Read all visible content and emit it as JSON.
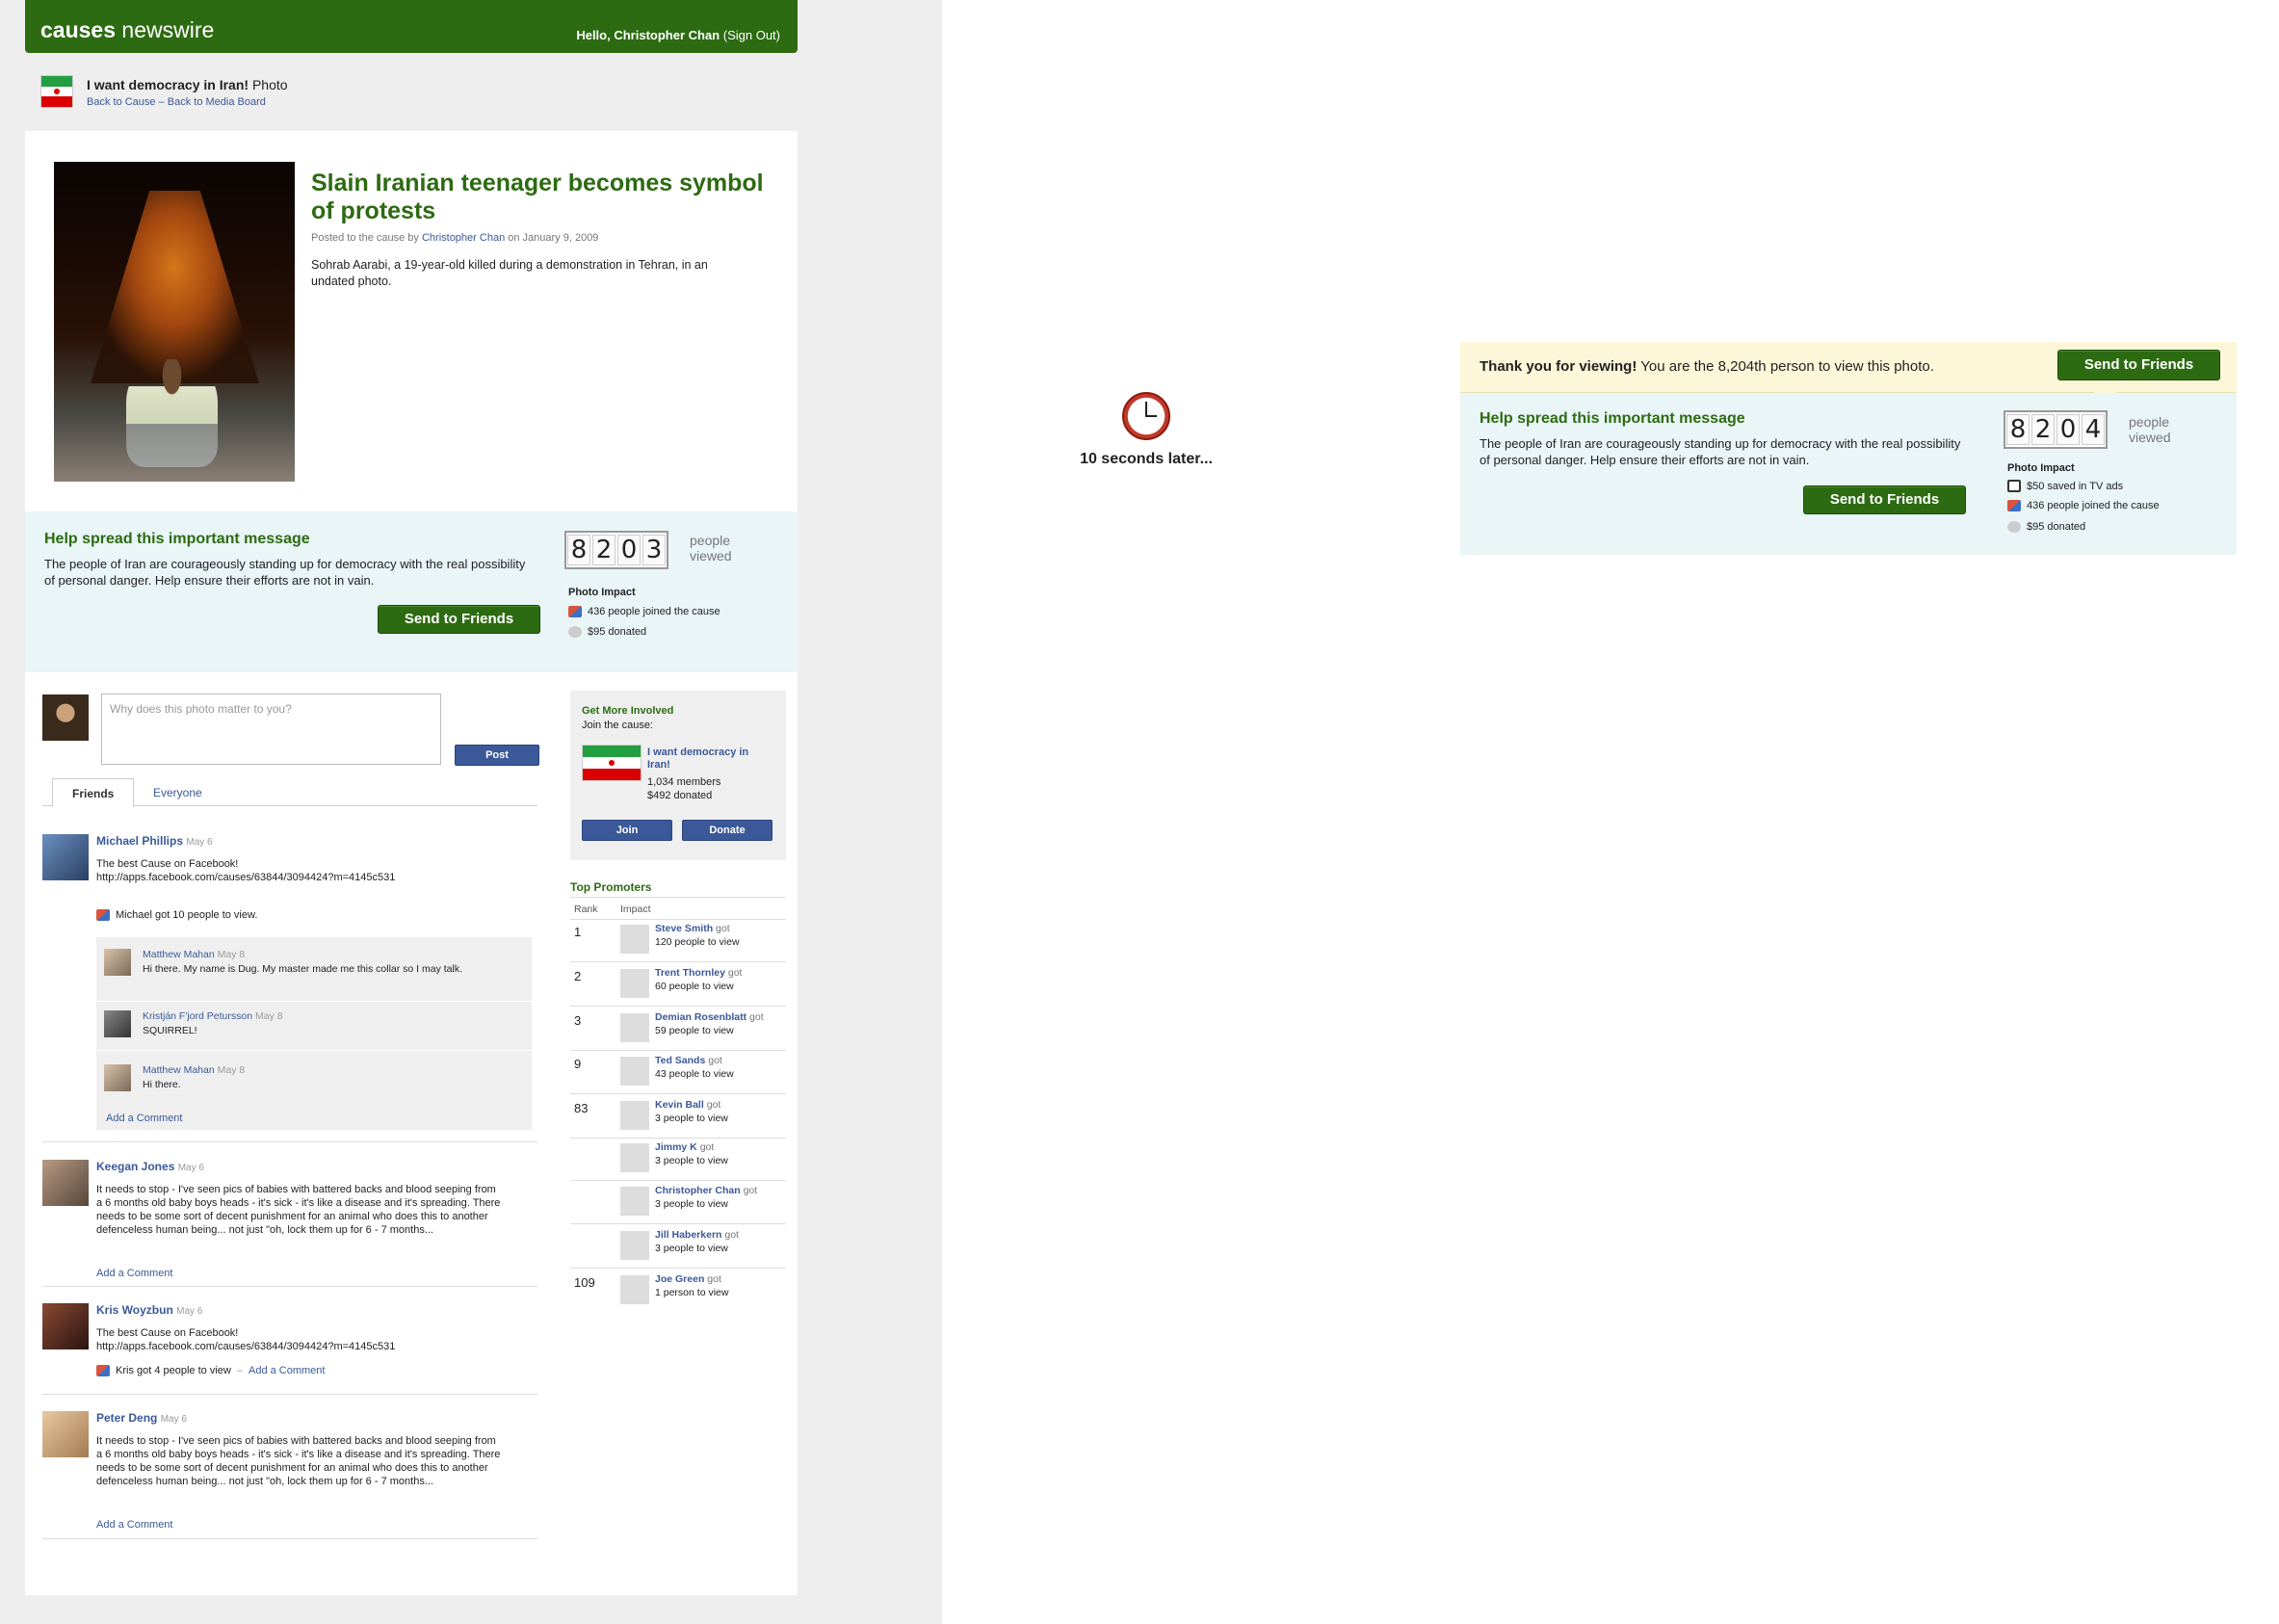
{
  "header": {
    "brand_bold": "causes",
    "brand_rest": " newswire",
    "greeting": "Hello, Christopher Chan",
    "signout": "(Sign Out)"
  },
  "cause_bar": {
    "title": "I want democracy in Iran!",
    "type": "Photo",
    "back_cause": "Back to Cause",
    "dash": " – ",
    "back_media": "Back to Media Board"
  },
  "article": {
    "headline": "Slain Iranian teenager becomes symbol of protests",
    "posted_prefix": "Posted to the cause by ",
    "posted_author": "Christopher Chan",
    "posted_suffix": " on January 9, 2009",
    "caption": "Sohrab Aarabi, a 19-year-old killed during a demonstration in Tehran, in an undated photo."
  },
  "spread": {
    "heading": "Help spread this important message",
    "body": "The people of Iran are courageously standing up for democracy with the real possibility of personal danger. Help ensure their efforts are not in vain.",
    "button": "Send to Friends",
    "digits": [
      "8",
      "2",
      "0",
      "3"
    ],
    "people_viewed": "people viewed",
    "impact_title": "Photo Impact",
    "impact_joined": "436 people joined the cause",
    "impact_donated": "$95 donated"
  },
  "comment": {
    "placeholder": "Why does this photo matter to you?",
    "post_button": "Post"
  },
  "tabs": {
    "friends": "Friends",
    "everyone": "Everyone"
  },
  "posts": [
    {
      "name": "Michael Phillips",
      "date": "May 6",
      "body": "The best Cause on Facebook!\nhttp://apps.facebook.com/causes/63844/3094424?m=4145c531",
      "meta": "Michael got 10 people to view."
    },
    {
      "name": "Keegan Jones",
      "date": "May 6",
      "body": "It needs to stop - I've seen pics of babies with battered backs and blood seeping from a 6 months old baby boys heads - it's sick - it's like a disease and it's spreading. There needs to be some sort of decent punishment for an animal who does this to another defenceless human being... not just \"oh, lock them up for 6 - 7 months...",
      "add_comment": "Add a Comment"
    },
    {
      "name": "Kris Woyzbun",
      "date": "May 6",
      "body": "The best Cause on Facebook!\nhttp://apps.facebook.com/causes/63844/3094424?m=4145c531",
      "meta": "Kris got 4 people to view",
      "meta_sep": " – ",
      "add_comment": "Add a Comment"
    },
    {
      "name": "Peter Deng",
      "date": "May 6",
      "body": "It needs to stop - I've seen pics of babies with battered backs and blood seeping from a 6 months old baby boys heads - it's sick - it's like a disease and it's spreading. There needs to be some sort of decent punishment for an animal who does this to another defenceless human being... not just \"oh, lock them up for 6 - 7 months...",
      "add_comment": "Add a Comment"
    }
  ],
  "replies": [
    {
      "name": "Matthew Mahan",
      "date": "May 8",
      "body": "Hi there. My name is Dug. My master made me this collar so I may talk."
    },
    {
      "name": "Kristján F'jord Petursson",
      "date": "May 8",
      "body": "SQUIRREL!"
    },
    {
      "name": "Matthew Mahan",
      "date": "May 8",
      "body": "Hi there."
    }
  ],
  "replies_add_comment": "Add a Comment",
  "involved": {
    "heading": "Get More Involved",
    "sub": "Join the cause:",
    "cause_name": "I want democracy in Iran!",
    "members": "1,034 members",
    "donated": "$492 donated",
    "join": "Join",
    "donate": "Donate"
  },
  "promoters": {
    "heading": "Top Promoters",
    "col_rank": "Rank",
    "col_impact": "Impact",
    "got": " got",
    "rows": [
      {
        "rank": "1",
        "name": "Steve Smith",
        "impact": "120 people to view"
      },
      {
        "rank": "2",
        "name": "Trent Thornley",
        "impact": "60 people to view"
      },
      {
        "rank": "3",
        "name": "Demian Rosenblatt",
        "impact": "59 people to view"
      },
      {
        "rank": "9",
        "name": "Ted Sands",
        "impact": "43 people to view"
      },
      {
        "rank": "83",
        "name": "Kevin Ball",
        "impact": "3 people to view"
      },
      {
        "rank": "",
        "name": "Jimmy K",
        "impact": "3 people to view"
      },
      {
        "rank": "",
        "name": "Christopher Chan",
        "impact": "3 people to view"
      },
      {
        "rank": "",
        "name": "Jill Haberkern",
        "impact": "3 people to view"
      },
      {
        "rank": "109",
        "name": "Joe Green",
        "impact": "1 person to view"
      }
    ]
  },
  "later": "10 seconds later...",
  "notice": {
    "bold": "Thank you for viewing!",
    "rest": " You are the 8,204th person to view this photo.",
    "button": "Send to Friends"
  },
  "spread2": {
    "heading": "Help spread this important message",
    "body": "The people of Iran are courageously standing up for democracy with the real possibility of personal danger. Help ensure their efforts are not in vain.",
    "button": "Send to Friends",
    "digits": [
      "8",
      "2",
      "0",
      "4"
    ],
    "people_viewed": "people viewed",
    "impact_title": "Photo Impact",
    "impact_tv": "$50 saved in TV ads",
    "impact_joined": "436 people joined the cause",
    "impact_donated": "$95 donated"
  },
  "colors": {
    "brand_green": "#2d6b12",
    "link_blue": "#3b5998",
    "spread_bg": "#e9f5f6",
    "notice_bg": "#fdf7d9"
  },
  "icons": [
    "clock-icon",
    "people-icon",
    "money-icon",
    "tv-icon",
    "iran-flag"
  ]
}
